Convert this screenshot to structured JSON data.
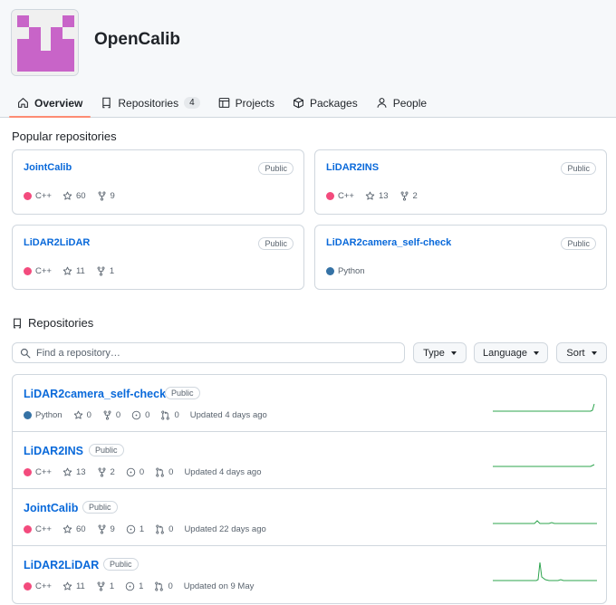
{
  "org": {
    "name": "OpenCalib"
  },
  "nav": {
    "overview": "Overview",
    "repositories": "Repositories",
    "repositories_count": "4",
    "projects": "Projects",
    "packages": "Packages",
    "people": "People"
  },
  "popular": {
    "title": "Popular repositories",
    "cards": [
      {
        "name": "JointCalib",
        "visibility": "Public",
        "language": "C++",
        "lang_color": "#f34b7d",
        "stars": "60",
        "forks": "9"
      },
      {
        "name": "LiDAR2INS",
        "visibility": "Public",
        "language": "C++",
        "lang_color": "#f34b7d",
        "stars": "13",
        "forks": "2"
      },
      {
        "name": "LiDAR2LiDAR",
        "visibility": "Public",
        "language": "C++",
        "lang_color": "#f34b7d",
        "stars": "11",
        "forks": "1"
      },
      {
        "name": "LiDAR2camera_self-check",
        "visibility": "Public",
        "language": "Python",
        "lang_color": "#3572a5"
      }
    ]
  },
  "repositories": {
    "title": "Repositories",
    "search_placeholder": "Find a repository…",
    "type_label": "Type",
    "language_label": "Language",
    "sort_label": "Sort",
    "items": [
      {
        "name": "LiDAR2camera_self-check",
        "visibility": "Public",
        "language": "Python",
        "lang_color": "#3572a5",
        "stars": "0",
        "forks": "0",
        "issues": "0",
        "prs": "0",
        "updated": "Updated 4 days ago"
      },
      {
        "name": "LiDAR2INS",
        "visibility": "Public",
        "language": "C++",
        "lang_color": "#f34b7d",
        "stars": "13",
        "forks": "2",
        "issues": "0",
        "prs": "0",
        "updated": "Updated 4 days ago"
      },
      {
        "name": "JointCalib",
        "visibility": "Public",
        "language": "C++",
        "lang_color": "#f34b7d",
        "stars": "60",
        "forks": "9",
        "issues": "1",
        "prs": "0",
        "updated": "Updated 22 days ago"
      },
      {
        "name": "LiDAR2LiDAR",
        "visibility": "Public",
        "language": "C++",
        "lang_color": "#f34b7d",
        "stars": "11",
        "forks": "1",
        "issues": "1",
        "prs": "0",
        "updated": "Updated on 9 May"
      }
    ]
  },
  "colors": {
    "accent": "#0969da",
    "nav_underline": "#fd8c73",
    "spark": "#2da44e",
    "logo": "#c864c8"
  }
}
